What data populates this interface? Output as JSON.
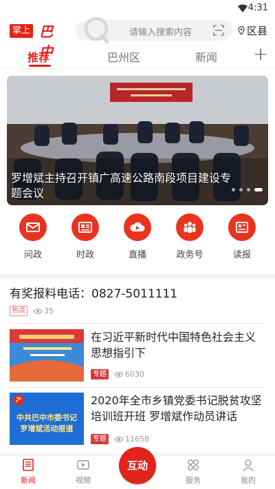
{
  "status_bar": {
    "time": "4:31"
  },
  "header": {
    "logo_box_text": "掌上",
    "logo_script_text": "巴中",
    "search_placeholder": "请输入搜索内容",
    "location": "区县"
  },
  "tabs": [
    {
      "label": "推荐",
      "active": true
    },
    {
      "label": "巴州区",
      "active": false
    },
    {
      "label": "新闻",
      "active": false
    }
  ],
  "banner": {
    "caption": "罗增斌主持召开镇广高速公路南段项目建设专题会议",
    "slide_count": 4,
    "active_slide": 1
  },
  "quick_links": [
    {
      "label": "问政",
      "icon": "mail-icon"
    },
    {
      "label": "时政",
      "icon": "id-card-icon"
    },
    {
      "label": "直播",
      "icon": "cloud-play-icon"
    },
    {
      "label": "政务号",
      "icon": "people-icon"
    },
    {
      "label": "读报",
      "icon": "newspaper-icon"
    }
  ],
  "hot_item": {
    "title": "有奖报料电话：0827-5011111",
    "tag": "热点",
    "views": "35"
  },
  "articles": [
    {
      "title": "在习近平新时代中国特色社会主义思想指引下",
      "tag": "专题",
      "views": "6030"
    },
    {
      "title": "2020年全市乡镇党委书记脱贫攻坚培训班开班 罗增斌作动员讲话",
      "tag": "专题",
      "views": "11658",
      "thumb_line1": "中共巴中市委书记",
      "thumb_line2": "罗增斌活动报道"
    }
  ],
  "bottom_nav": {
    "items": [
      {
        "label": "新闻",
        "active": true
      },
      {
        "label": "视频",
        "active": false
      },
      {
        "label": "服务",
        "active": false
      },
      {
        "label": "我的",
        "active": false
      }
    ],
    "center_label": "互动"
  },
  "colors": {
    "brand_red": "#e2231a"
  }
}
